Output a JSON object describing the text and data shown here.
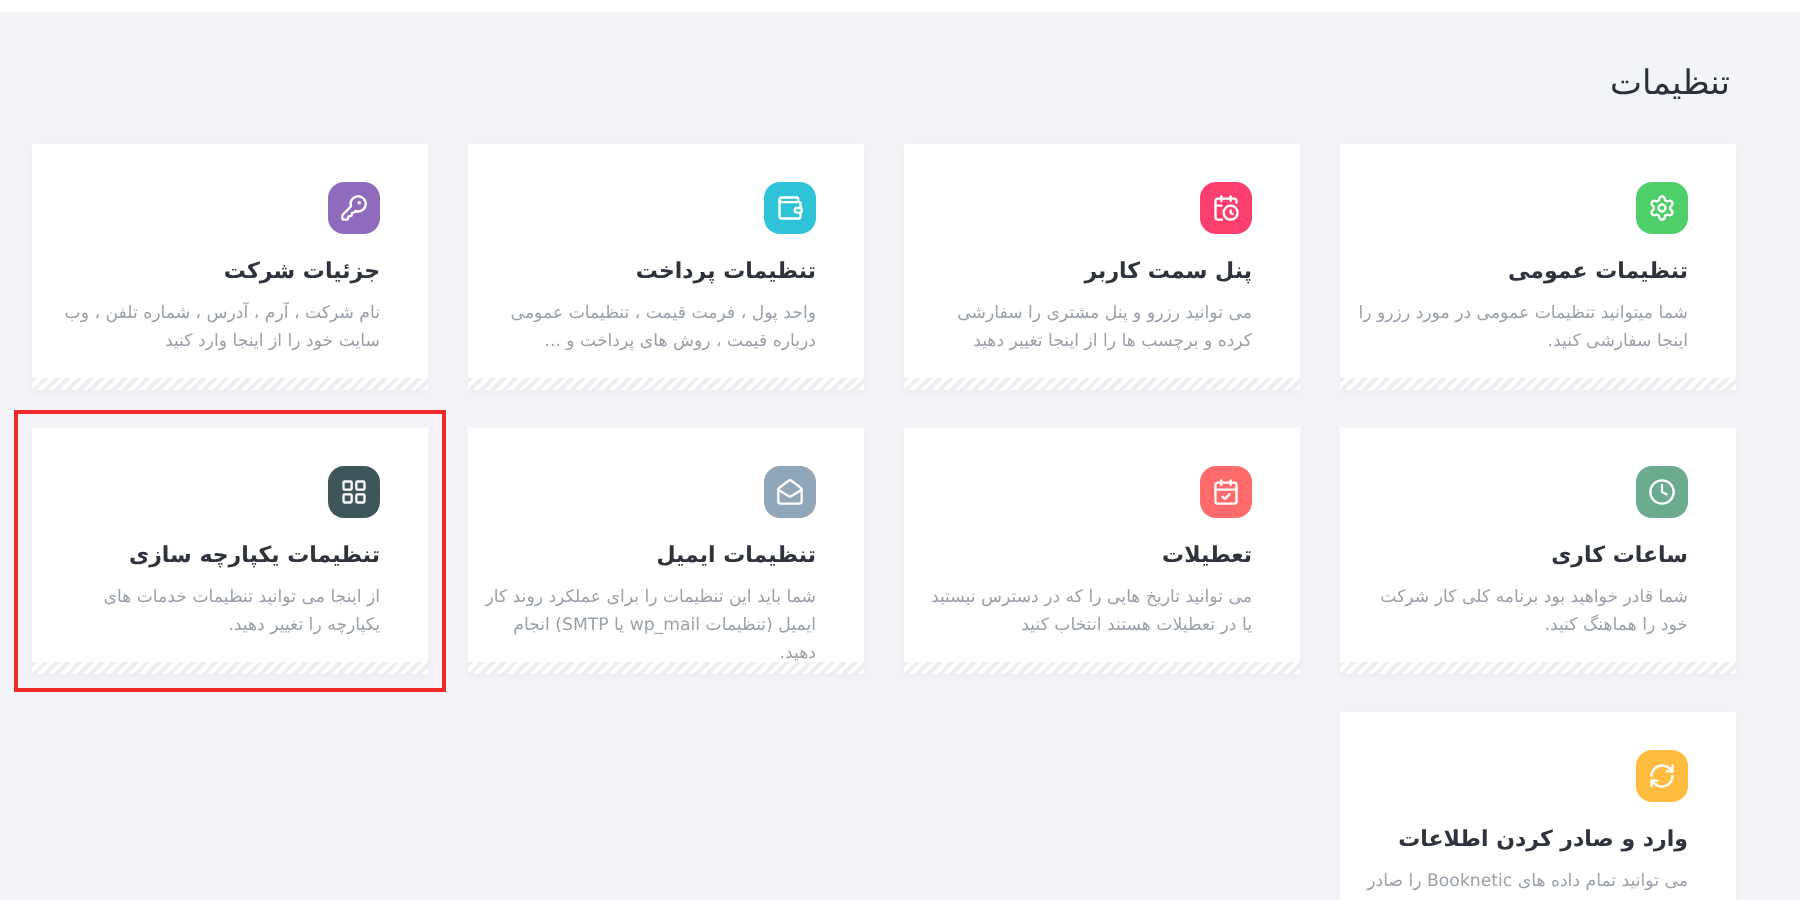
{
  "title": "تنظیمات",
  "cards": [
    {
      "color": "#4fcf6a",
      "title": "تنظیمات عمومی",
      "description": "شما میتوانید تنظیمات عمومی در مورد رزرو را اینجا سفارشی کنید.",
      "highlighted": false
    },
    {
      "color": "#fb3f6f",
      "title": "پنل سمت کاربر",
      "description": "می توانید رزرو و پنل مشتری را سفارشی کرده و برچسب ها را از اینجا تغییر دهید",
      "highlighted": false
    },
    {
      "color": "#2ec3d6",
      "title": "تنظیمات پرداخت",
      "description": "واحد پول ، فرمت قیمت ، تنظیمات عمومی درباره قیمت ، روش های پرداخت و ...",
      "highlighted": false
    },
    {
      "color": "#8e6bbd",
      "title": "جزئیات شرکت",
      "description": "نام شرکت ، آرم ، آدرس ، شماره تلفن ، وب سایت خود را از اینجا وارد کنید",
      "highlighted": false
    },
    {
      "color": "#6bac8f",
      "title": "ساعات کاری",
      "description": "شما قادر خواهید بود برنامه کلی کار شرکت خود را هماهنگ کنید.",
      "highlighted": false
    },
    {
      "color": "#ff6b6b",
      "title": "تعطیلات",
      "description": "می توانید تاریخ هایی را که در دسترس نیستید یا در تعطیلات هستند انتخاب کنید",
      "highlighted": false
    },
    {
      "color": "#90a6b9",
      "title": "تنظیمات ایمیل",
      "description": "شما باید این تنظیمات را برای عملکرد روند کار ایمیل (تنظیمات wp_mail یا SMTP) انجام دهید.",
      "highlighted": false
    },
    {
      "color": "#3e555a",
      "title": "تنظیمات یکپارچه سازی",
      "description": "از اینجا می توانید تنظیمات خدمات های یکپارچه را تغییر دهید.",
      "highlighted": true
    },
    {
      "color": "#ffbc3f",
      "title": "وارد و صادر کردن اطلاعات",
      "description": "می توانید تمام داده های Booknetic را صادر",
      "highlighted": false
    }
  ]
}
